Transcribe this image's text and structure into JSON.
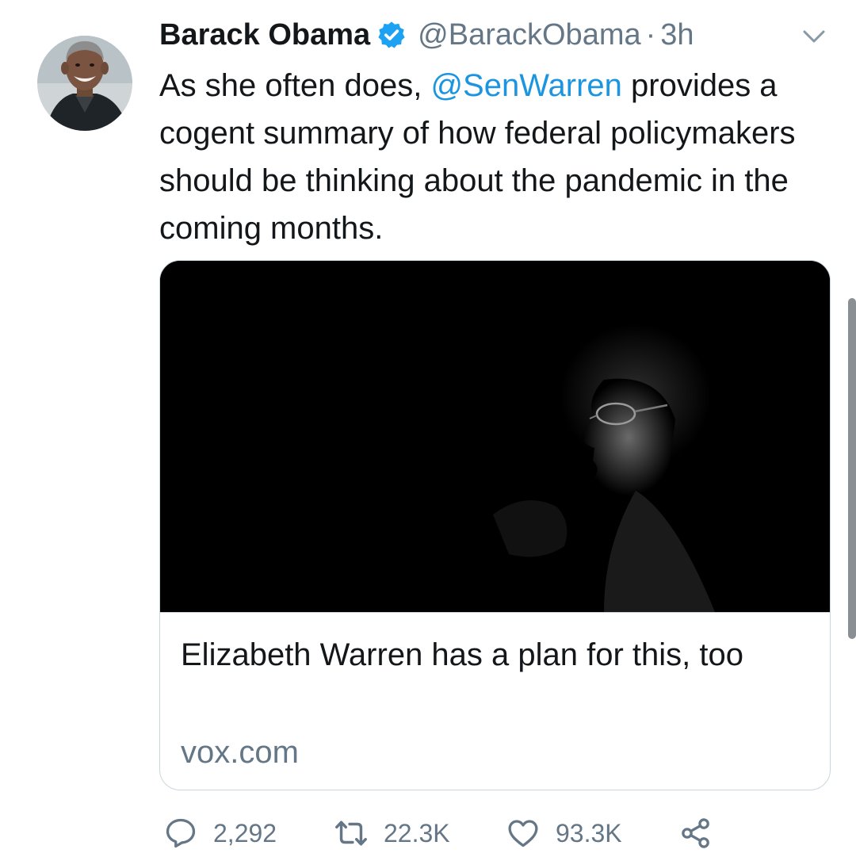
{
  "tweet": {
    "author": {
      "display_name": "Barack Obama",
      "handle": "@BarackObama",
      "verified": true
    },
    "separator": "·",
    "time": "3h",
    "text_parts": {
      "before": "As she often does, ",
      "mention": "@SenWarren",
      "after": " provides a cogent summary of how federal policymakers should be thinking about the pandemic in the coming months."
    },
    "card": {
      "title": "Elizabeth Warren has a plan for this, too",
      "domain": "vox.com"
    },
    "actions": {
      "replies": "2,292",
      "retweets": "22.3K",
      "likes": "93.3K"
    }
  },
  "icons": {
    "verified": "verified-badge-icon",
    "caret": "chevron-down-icon",
    "reply": "reply-icon",
    "retweet": "retweet-icon",
    "like": "heart-icon",
    "share": "share-icon"
  },
  "colors": {
    "text": "#14171a",
    "secondary": "#657786",
    "link": "#1b95e0",
    "verified": "#1da1f2",
    "border": "#ccd6dd"
  }
}
